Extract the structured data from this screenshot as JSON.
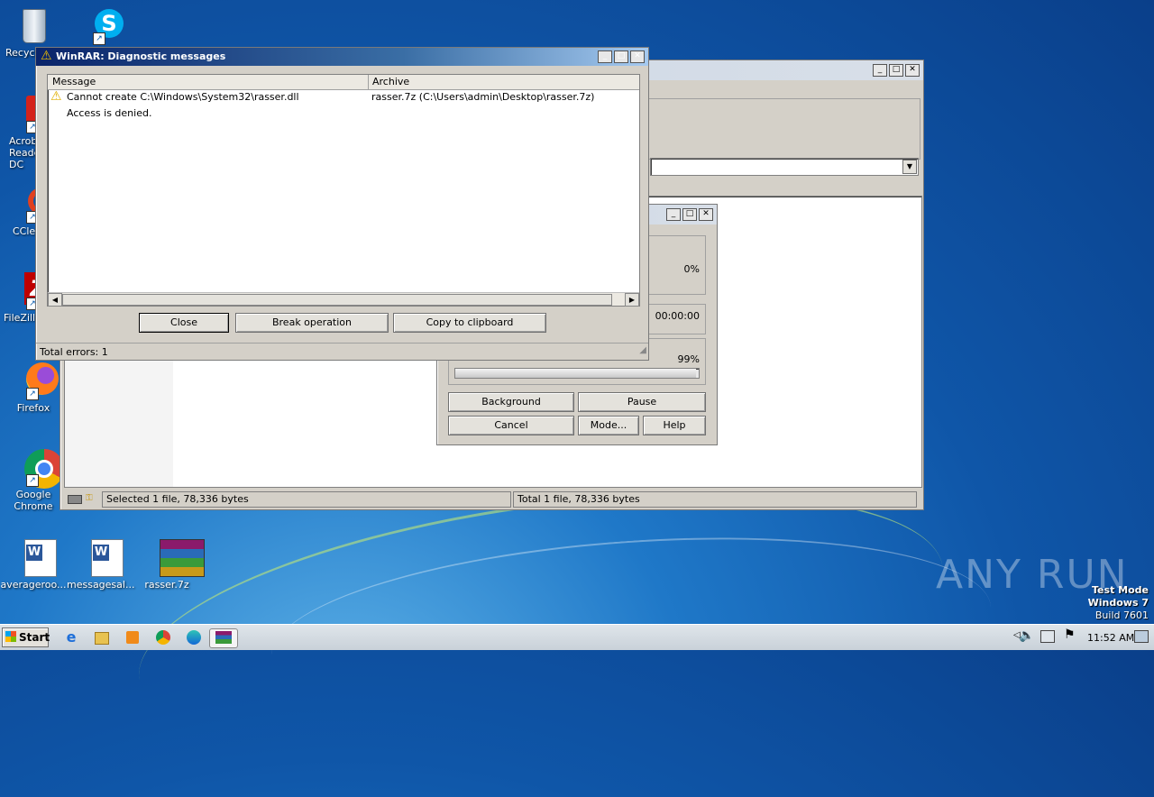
{
  "desktop": {
    "icons": [
      {
        "label": "Recycle Bin"
      },
      {
        "label": "Skype"
      },
      {
        "label": "Acrobat Reader DC"
      },
      {
        "label": "CCleaner"
      },
      {
        "label": "FileZilla"
      },
      {
        "label": "Firefox"
      },
      {
        "label": "Google Chrome"
      },
      {
        "label": "averageroo..."
      },
      {
        "label": "messagesal..."
      },
      {
        "label": "rasser.7z"
      }
    ],
    "watermark": "ANY RUN",
    "test_mode": [
      "Test Mode",
      "Windows 7",
      "Build 7601"
    ]
  },
  "diag": {
    "title": "WinRAR: Diagnostic messages",
    "col_message": "Message",
    "col_archive": "Archive",
    "row1_message": "Cannot create C:\\Windows\\System32\\rasser.dll",
    "row1_archive": "rasser.7z (C:\\Users\\admin\\Desktop\\rasser.7z)",
    "row2_message": "Access is denied.",
    "btn_close": "Close",
    "btn_break": "Break operation",
    "btn_copy": "Copy to clipboard",
    "status": "Total errors: 1"
  },
  "winrar": {
    "status_left": "Selected 1 file, 78,336 bytes",
    "status_right": "Total 1 file, 78,336 bytes"
  },
  "progress": {
    "pct_file": "0%",
    "time": "00:00:00",
    "pct_total": "99%",
    "total_fill": 0.99,
    "btn_background": "Background",
    "btn_pause": "Pause",
    "btn_cancel": "Cancel",
    "btn_mode": "Mode...",
    "btn_help": "Help"
  },
  "taskbar": {
    "start": "Start",
    "clock": "11:52 AM"
  }
}
